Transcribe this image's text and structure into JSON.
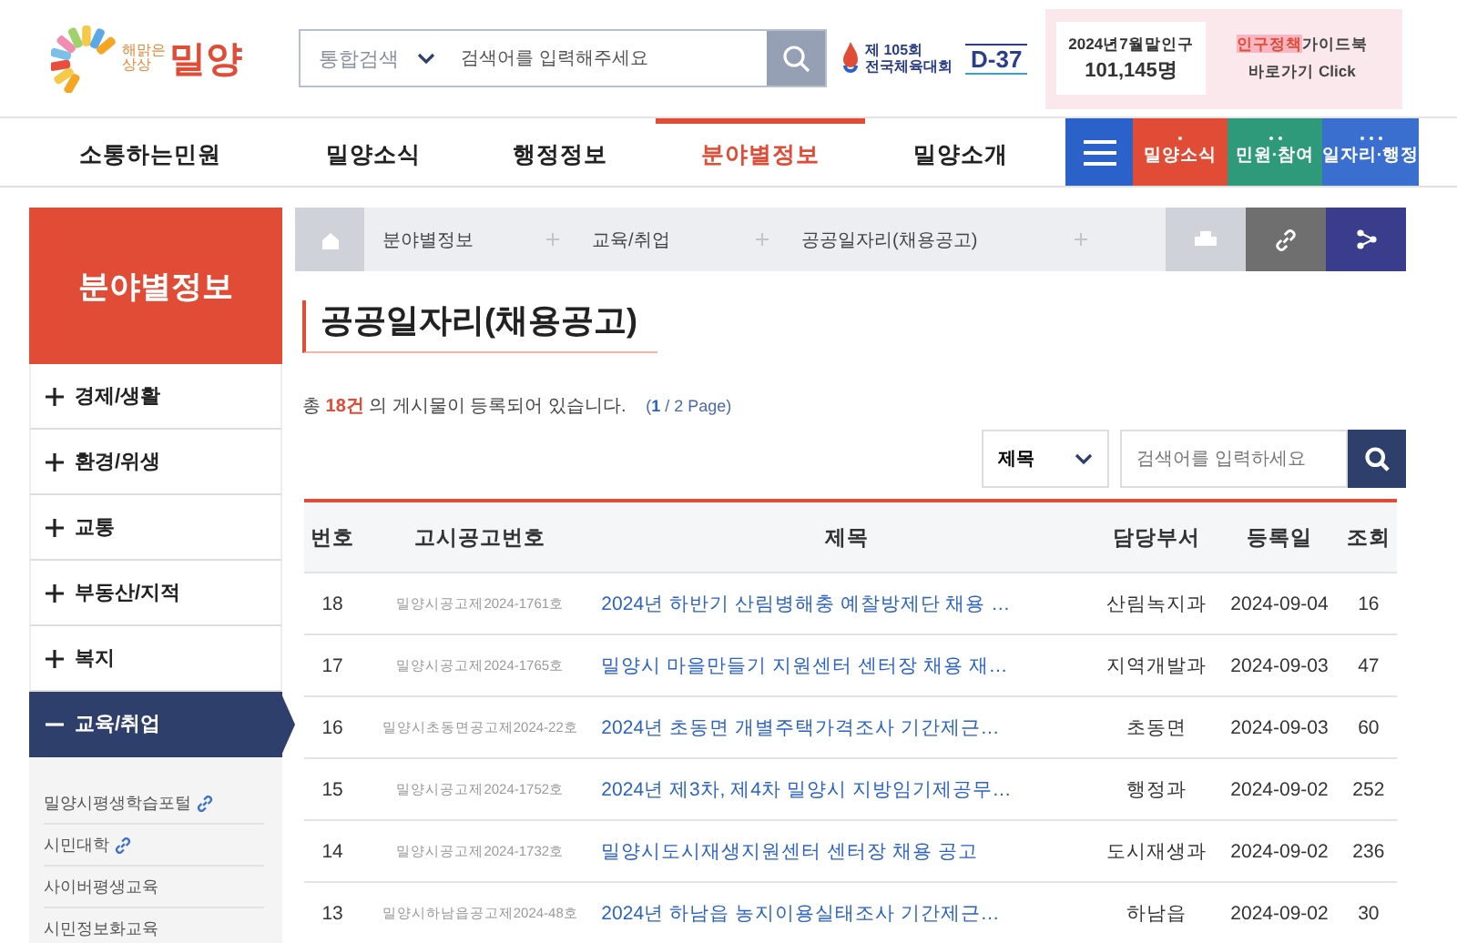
{
  "logo": {
    "tagline_1": "해맑은",
    "tagline_2": "상상",
    "name": "밀양"
  },
  "search": {
    "scope": "통합검색",
    "placeholder": "검색어를 입력해주세요"
  },
  "event_banner": {
    "line_1": "제 105회",
    "line_2": "전국체육대회",
    "countdown": "D-37"
  },
  "population": {
    "label": "2024년7월말인구",
    "value": "101,145명"
  },
  "guidebook": {
    "highlight": "인구정책",
    "title": "가이드북",
    "link": "바로가기 Click"
  },
  "main_nav": [
    {
      "label": "소통하는민원",
      "selected": false
    },
    {
      "label": "밀양소식",
      "selected": false
    },
    {
      "label": "행정정보",
      "selected": false
    },
    {
      "label": "분야별정보",
      "selected": true
    },
    {
      "label": "밀양소개",
      "selected": false
    }
  ],
  "quick_menu": [
    {
      "label": "밀양소식",
      "color": "#e04c35"
    },
    {
      "label": "민원·참여",
      "color": "#2e9a7a"
    },
    {
      "label": "일자리·행정",
      "color": "#3a6fd0"
    }
  ],
  "sidebar": {
    "title": "분야별정보",
    "items": [
      {
        "label": "경제/생활",
        "expanded": false
      },
      {
        "label": "환경/위생",
        "expanded": false
      },
      {
        "label": "교통",
        "expanded": false
      },
      {
        "label": "부동산/지적",
        "expanded": false
      },
      {
        "label": "복지",
        "expanded": false
      },
      {
        "label": "교육/취업",
        "expanded": true,
        "children": [
          {
            "label": "밀양시평생학습포털",
            "external": true
          },
          {
            "label": "시민대학",
            "external": true
          },
          {
            "label": "사이버평생교육",
            "external": false
          },
          {
            "label": "시민정보화교육",
            "external": false
          }
        ]
      }
    ]
  },
  "breadcrumb": [
    "분야별정보",
    "교육/취업",
    "공공일자리(채용공고)"
  ],
  "page_title": "공공일자리(채용공고)",
  "summary": {
    "prefix": "총",
    "count": "18건",
    "suffix": "의 게시물이 등록되어 있습니다.",
    "page_current": "1",
    "page_total": "/ 2 Page)",
    "page_open": "("
  },
  "filter": {
    "field": "제목",
    "placeholder": "검색어를 입력하세요"
  },
  "table": {
    "columns": [
      "번호",
      "고시공고번호",
      "제목",
      "담당부서",
      "등록일",
      "조회"
    ],
    "rows": [
      [
        "18",
        "밀양시공고제2024-1761호",
        "2024년 하반기 산림병해충 예찰방제단 채용 …",
        "산림녹지과",
        "2024-09-04",
        "16"
      ],
      [
        "17",
        "밀양시공고제2024-1765호",
        "밀양시 마을만들기 지원센터 센터장 채용 재…",
        "지역개발과",
        "2024-09-03",
        "47"
      ],
      [
        "16",
        "밀양시초동면공고제2024-22호",
        "2024년 초동면 개별주택가격조사 기간제근…",
        "초동면",
        "2024-09-03",
        "60"
      ],
      [
        "15",
        "밀양시공고제2024-1752호",
        "2024년 제3차, 제4차 밀양시 지방임기제공무…",
        "행정과",
        "2024-09-02",
        "252"
      ],
      [
        "14",
        "밀양시공고제2024-1732호",
        "밀양시도시재생지원센터 센터장 채용 공고",
        "도시재생과",
        "2024-09-02",
        "236"
      ],
      [
        "13",
        "밀양시하남읍공고제2024-48호",
        "2024년 하남읍 농지이용실태조사 기간제근…",
        "하남읍",
        "2024-09-02",
        "30"
      ]
    ]
  }
}
